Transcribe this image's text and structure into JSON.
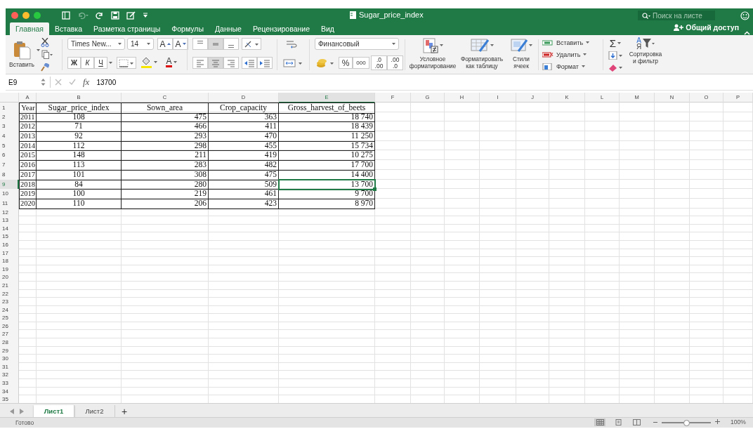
{
  "window": {
    "title": "Sugar_price_index",
    "search_placeholder": "Поиск на листе"
  },
  "ribbon_tabs": [
    {
      "label": "Главная",
      "selected": true
    },
    {
      "label": "Вставка",
      "selected": false
    },
    {
      "label": "Разметка страницы",
      "selected": false
    },
    {
      "label": "Формулы",
      "selected": false
    },
    {
      "label": "Данные",
      "selected": false
    },
    {
      "label": "Рецензирование",
      "selected": false
    },
    {
      "label": "Вид",
      "selected": false
    }
  ],
  "share_button": "Общий доступ",
  "clipboard": {
    "paste": "Вставить"
  },
  "font": {
    "name": "Times New...",
    "size": "14",
    "grow": "A",
    "shrink": "A",
    "bold": "Ж",
    "italic": "К",
    "underline": "Ч",
    "font_color_letter": "A"
  },
  "number": {
    "format": "Финансовый",
    "percent": "%",
    "thousands": "000",
    "increase_decimal": [
      ".0",
      ".00"
    ],
    "decrease_decimal": [
      ".00",
      ".0"
    ]
  },
  "styles": {
    "conditional": "Условное\nформатирование",
    "as_table": "Форматировать\nкак таблицу",
    "cell_styles": "Стили\nячеек"
  },
  "cells": [
    {
      "label": "Вставить",
      "kind": "insert"
    },
    {
      "label": "Удалить",
      "kind": "delete"
    },
    {
      "label": "Формат",
      "kind": "format"
    }
  ],
  "editing": {
    "sum": "Σ"
  },
  "sort": {
    "letters": [
      "А",
      "Я"
    ],
    "label": "Сортировка\nи фильтр"
  },
  "formula_bar": {
    "name_box": "E9",
    "function_label": "fx",
    "formula": "13700"
  },
  "sheet": {
    "columns": [
      {
        "letter": "A",
        "selected": false
      },
      {
        "letter": "B",
        "selected": false
      },
      {
        "letter": "C",
        "selected": false
      },
      {
        "letter": "D",
        "selected": false
      },
      {
        "letter": "E",
        "selected": true
      },
      {
        "letter": "F",
        "selected": false
      },
      {
        "letter": "G",
        "selected": false
      },
      {
        "letter": "H",
        "selected": false
      },
      {
        "letter": "I",
        "selected": false
      },
      {
        "letter": "J",
        "selected": false
      },
      {
        "letter": "K",
        "selected": false
      },
      {
        "letter": "L",
        "selected": false
      },
      {
        "letter": "M",
        "selected": false
      },
      {
        "letter": "N",
        "selected": false
      },
      {
        "letter": "O",
        "selected": false
      },
      {
        "letter": "P",
        "selected": false
      }
    ],
    "rows": [
      {
        "number": "1",
        "selected": false,
        "cells": [
          "Year",
          "Sugar_price_index",
          "Sown_area",
          "Crop_capacity",
          "Gross_harvest_of_beets"
        ]
      },
      {
        "number": "2",
        "selected": false,
        "cells": [
          "2011",
          "108",
          "475",
          "363",
          "18 740"
        ]
      },
      {
        "number": "3",
        "selected": false,
        "cells": [
          "2012",
          "71",
          "466",
          "411",
          "18 439"
        ]
      },
      {
        "number": "4",
        "selected": false,
        "cells": [
          "2013",
          "92",
          "293",
          "470",
          "11 250"
        ]
      },
      {
        "number": "5",
        "selected": false,
        "cells": [
          "2014",
          "112",
          "298",
          "455",
          "15 734"
        ]
      },
      {
        "number": "6",
        "selected": false,
        "cells": [
          "2015",
          "148",
          "211",
          "419",
          "10 275"
        ]
      },
      {
        "number": "7",
        "selected": false,
        "cells": [
          "2016",
          "113",
          "283",
          "482",
          "17 700"
        ]
      },
      {
        "number": "8",
        "selected": false,
        "cells": [
          "2017",
          "101",
          "308",
          "475",
          "14 400"
        ]
      },
      {
        "number": "9",
        "selected": true,
        "cells": [
          "2018",
          "84",
          "280",
          "509",
          "13 700"
        ]
      },
      {
        "number": "10",
        "selected": false,
        "cells": [
          "2019",
          "100",
          "219",
          "461",
          "9 700"
        ]
      },
      {
        "number": "11",
        "selected": false,
        "cells": [
          "2020",
          "110",
          "206",
          "423",
          "8 970"
        ]
      },
      {
        "number": "12",
        "selected": false
      },
      {
        "number": "13",
        "selected": false
      },
      {
        "number": "14",
        "selected": false
      },
      {
        "number": "15",
        "selected": false
      },
      {
        "number": "16",
        "selected": false
      },
      {
        "number": "17",
        "selected": false
      },
      {
        "number": "18",
        "selected": false
      },
      {
        "number": "19",
        "selected": false
      },
      {
        "number": "20",
        "selected": false
      },
      {
        "number": "21",
        "selected": false
      },
      {
        "number": "22",
        "selected": false
      },
      {
        "number": "23",
        "selected": false
      },
      {
        "number": "24",
        "selected": false
      },
      {
        "number": "25",
        "selected": false
      },
      {
        "number": "26",
        "selected": false
      },
      {
        "number": "27",
        "selected": false
      },
      {
        "number": "28",
        "selected": false
      },
      {
        "number": "29",
        "selected": false
      },
      {
        "number": "30",
        "selected": false
      },
      {
        "number": "31",
        "selected": false
      },
      {
        "number": "32",
        "selected": false
      },
      {
        "number": "33",
        "selected": false
      },
      {
        "number": "34",
        "selected": false
      },
      {
        "number": "35",
        "selected": false
      }
    ]
  },
  "sheet_tabs": [
    {
      "label": "Лист1",
      "selected": true
    },
    {
      "label": "Лист2",
      "selected": false
    }
  ],
  "add_sheet": "+",
  "status_bar": {
    "text": "Готово",
    "zoom": {
      "level": 0.5,
      "reading": "100%"
    }
  }
}
